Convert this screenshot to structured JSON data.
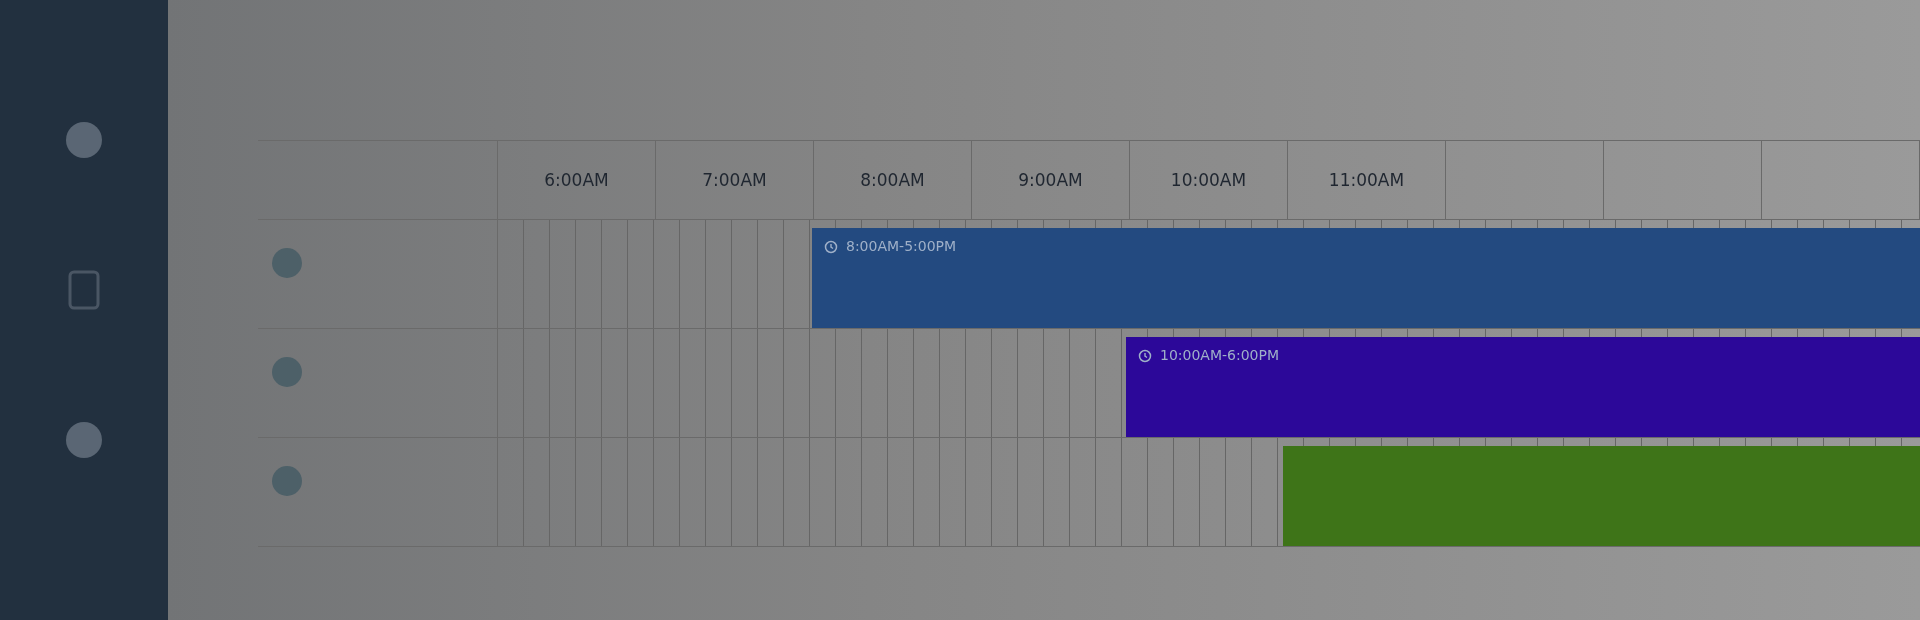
{
  "timeline": {
    "hours": [
      "6:00AM",
      "7:00AM",
      "8:00AM",
      "9:00AM",
      "10:00AM",
      "11:00AM"
    ],
    "rows": [
      {
        "shift": {
          "label": "8:00AM-5:00PM",
          "color": "#234a80"
        }
      },
      {
        "shift": {
          "label": "10:00AM-6:00PM",
          "color": "#2c0899"
        }
      },
      {
        "shift": {
          "color": "#3e7418"
        }
      }
    ]
  }
}
